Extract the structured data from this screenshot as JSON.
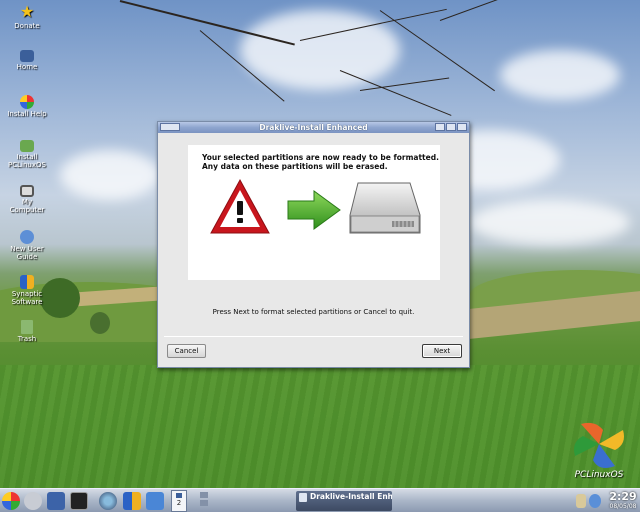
{
  "desktop": {
    "icons": [
      {
        "label": "Donate",
        "icon": "star-icon"
      },
      {
        "label": "Home",
        "icon": "home-folder-icon"
      },
      {
        "label": "Install Help",
        "icon": "help-icon"
      },
      {
        "label_lines": [
          "Install",
          "PCLinuxOS"
        ],
        "icon": "install-icon"
      },
      {
        "label_lines": [
          "My",
          "Computer"
        ],
        "icon": "computer-icon"
      },
      {
        "label_lines": [
          "New User",
          "Guide"
        ],
        "icon": "guide-icon"
      },
      {
        "label_lines": [
          "Synaptic",
          "Software"
        ],
        "icon": "synaptic-icon"
      },
      {
        "label": "Trash",
        "icon": "trash-icon"
      }
    ],
    "logo_text": "PCLinuxOS"
  },
  "dialog": {
    "title": "Draklive-Install Enhanced",
    "message_line1": "Your selected partitions are now ready to be formatted.",
    "message_line2": "Any data on these partitions will be erased.",
    "hint": "Press Next to format selected partitions or Cancel to quit.",
    "cancel_label": "Cancel",
    "next_label": "Next",
    "colors": {
      "warning": "#c8161d",
      "arrow": "#48a828"
    }
  },
  "taskbar": {
    "pager_label": "2",
    "active_task": "Draklive-Install Enh",
    "clock_time": "2:29",
    "clock_date": "08/05/08"
  }
}
